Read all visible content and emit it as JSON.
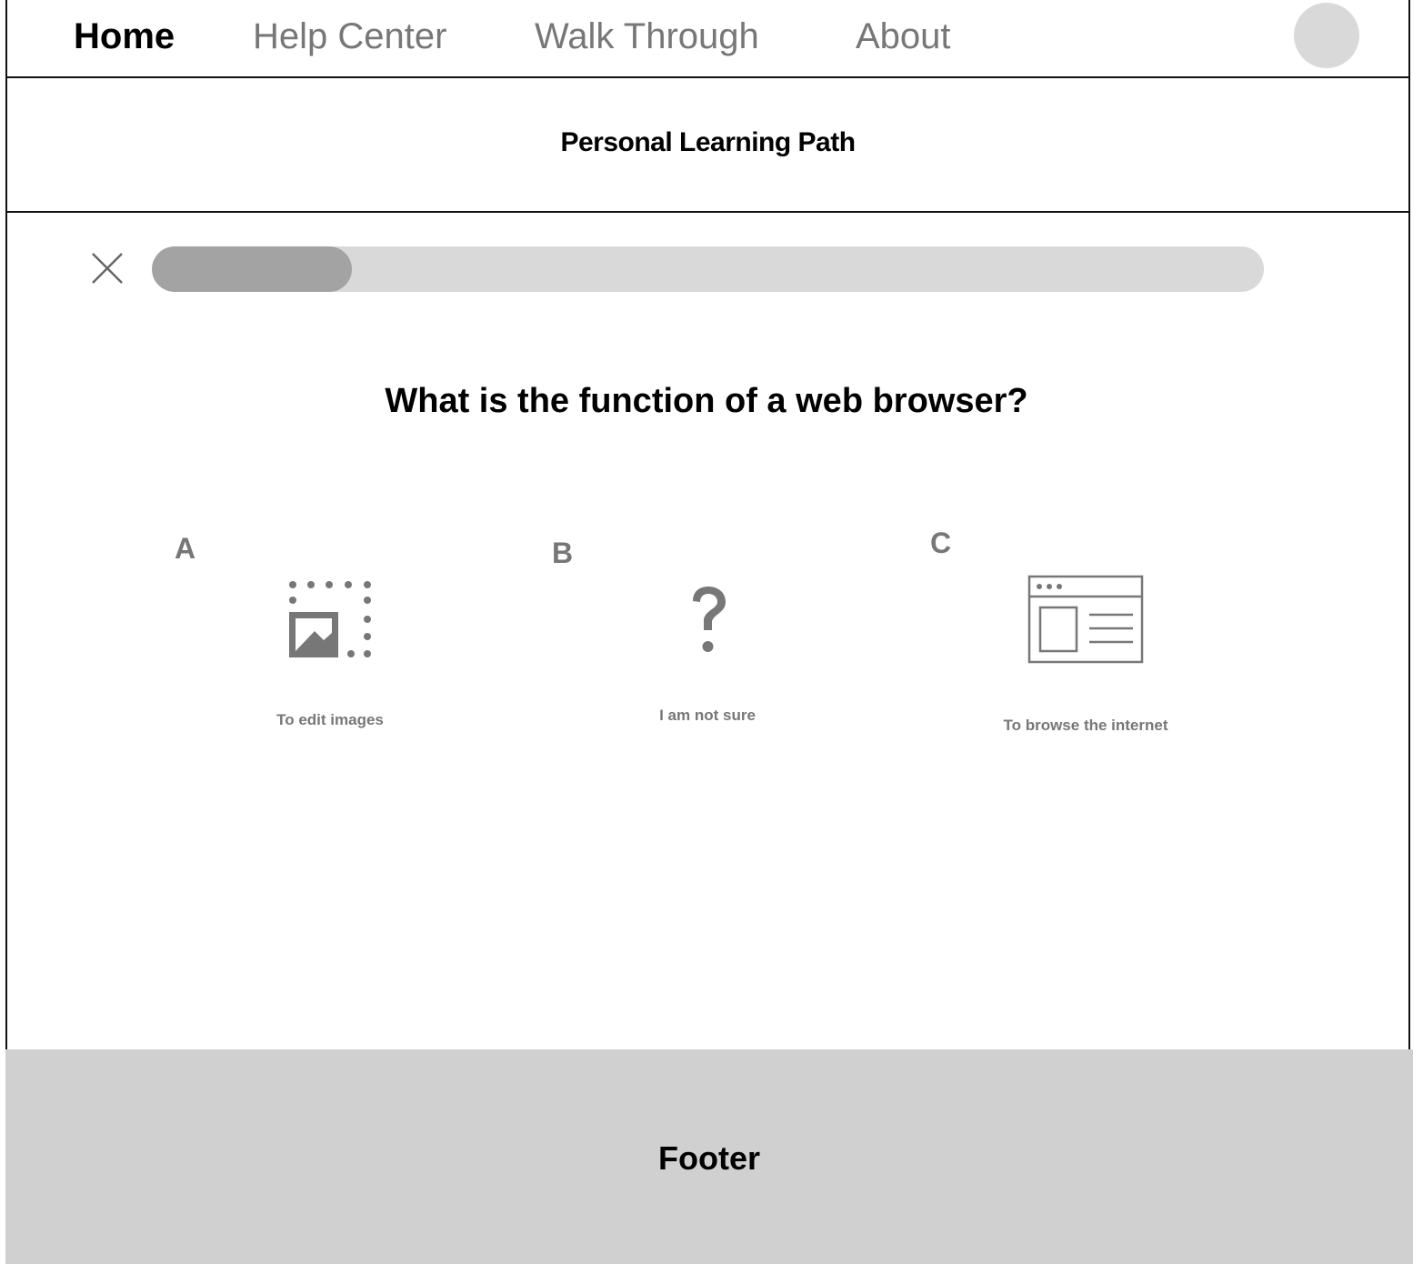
{
  "nav": {
    "items": [
      {
        "label": "Home",
        "active": true
      },
      {
        "label": "Help Center",
        "active": false
      },
      {
        "label": "Walk Through",
        "active": false
      },
      {
        "label": "About",
        "active": false
      }
    ]
  },
  "header": {
    "title": "Personal Learning Path"
  },
  "quiz": {
    "progress": 0.18,
    "question": "What is the function of a web browser?",
    "options": [
      {
        "letter": "A",
        "label": "To edit images",
        "icon": "image-crop-icon"
      },
      {
        "letter": "B",
        "label": "I am not sure",
        "icon": "question-mark-icon"
      },
      {
        "letter": "C",
        "label": "To browse the internet",
        "icon": "browser-window-icon"
      }
    ]
  },
  "footer": {
    "label": "Footer"
  },
  "colors": {
    "progress_track": "#d9d9d9",
    "progress_fill": "#a3a3a3",
    "footer_bg": "#d0d0d0",
    "muted_text": "#777777"
  }
}
